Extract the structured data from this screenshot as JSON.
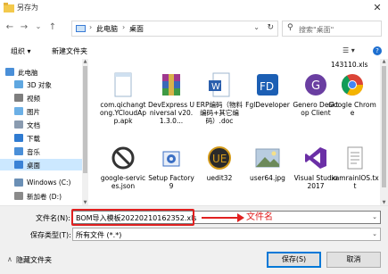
{
  "window": {
    "title": "另存为",
    "close_glyph": "✕"
  },
  "nav_buttons": {
    "back": "←",
    "forward": "→",
    "dropdown": "⌄",
    "up": "↑"
  },
  "address": {
    "crumbs": [
      "此电脑",
      "桌面"
    ],
    "separator": "›",
    "dropdown_glyph": "⌄",
    "refresh_glyph": "↻"
  },
  "search": {
    "placeholder": "搜索\"桌面\"",
    "icon_glyph": "⚲"
  },
  "toolbar": {
    "organize": "组织 ▾",
    "new_folder": "新建文件夹",
    "view_glyph": "☰ ▾",
    "help_glyph": "?"
  },
  "nav_items": [
    {
      "label": "此电脑",
      "icon": "computer-icon",
      "color": "#4a8fd8"
    },
    {
      "label": "3D 对象",
      "icon": "cube-icon",
      "color": "#5fa7e0"
    },
    {
      "label": "视频",
      "icon": "video-icon",
      "color": "#7e7e7e"
    },
    {
      "label": "图片",
      "icon": "pictures-icon",
      "color": "#6cb0e6"
    },
    {
      "label": "文档",
      "icon": "documents-icon",
      "color": "#8a9bb0"
    },
    {
      "label": "下载",
      "icon": "download-icon",
      "color": "#2f7bd1"
    },
    {
      "label": "音乐",
      "icon": "music-icon",
      "color": "#4a8fd8"
    },
    {
      "label": "桌面",
      "icon": "desktop-icon",
      "color": "#3a82d6"
    },
    {
      "label": "Windows (C:)",
      "icon": "drive-icon",
      "color": "#6b8fb5"
    },
    {
      "label": "新加卷 (D:)",
      "icon": "drive-icon",
      "color": "#8a8a8a"
    }
  ],
  "files_top_partial": "143110.xls",
  "files": [
    {
      "name": "com.qichangtong.YCloudApp.apk",
      "icon": "apk-icon",
      "color": "#8fb1d6"
    },
    {
      "name": "DevExpress Universal v20.1.3.0...",
      "icon": "winrar-icon",
      "color": "#8b2e7e"
    },
    {
      "name": "ERP编码（物料编码+其它编码）.doc",
      "icon": "word-icon",
      "color": "#2b5fad"
    },
    {
      "name": "FglDeveloper",
      "icon": "fgl-icon",
      "color": "#1c5fb4"
    },
    {
      "name": "Genero Desktop Client",
      "icon": "genero-icon",
      "color": "#6a3ea1"
    },
    {
      "name": "Google Chrome",
      "icon": "chrome-icon",
      "color": "#db4437"
    },
    {
      "name": "google-services.json",
      "icon": "json-icon",
      "color": "#333333"
    },
    {
      "name": "Setup Factory 9",
      "icon": "setup-icon",
      "color": "#3b6fc4"
    },
    {
      "name": "uedit32",
      "icon": "uedit-icon",
      "color": "#d39a1a"
    },
    {
      "name": "user64.jpg",
      "icon": "image-icon",
      "color": "#6c8aa8"
    },
    {
      "name": "Visual Studio 2017",
      "icon": "vs-icon",
      "color": "#6b2fa6"
    },
    {
      "name": "xamrainIOS.txt",
      "icon": "text-icon",
      "color": "#888888"
    }
  ],
  "form": {
    "filename_label": "文件名(N):",
    "filename_value": "BOM导入模板20220210162352.xls",
    "filename_dd": "⌄",
    "filetype_label": "保存类型(T):",
    "filetype_value": "所有文件 (*.*)",
    "filetype_dd": "⌄",
    "annotation": "文件名",
    "hide_folders": "隐藏文件夹",
    "hide_chevron": "∧",
    "save_button": "保存(S)",
    "cancel_button": "取消"
  },
  "colors": {
    "annotation_red": "#e02020",
    "selection_blue": "#cce8ff",
    "accent_blue": "#0078d7"
  }
}
